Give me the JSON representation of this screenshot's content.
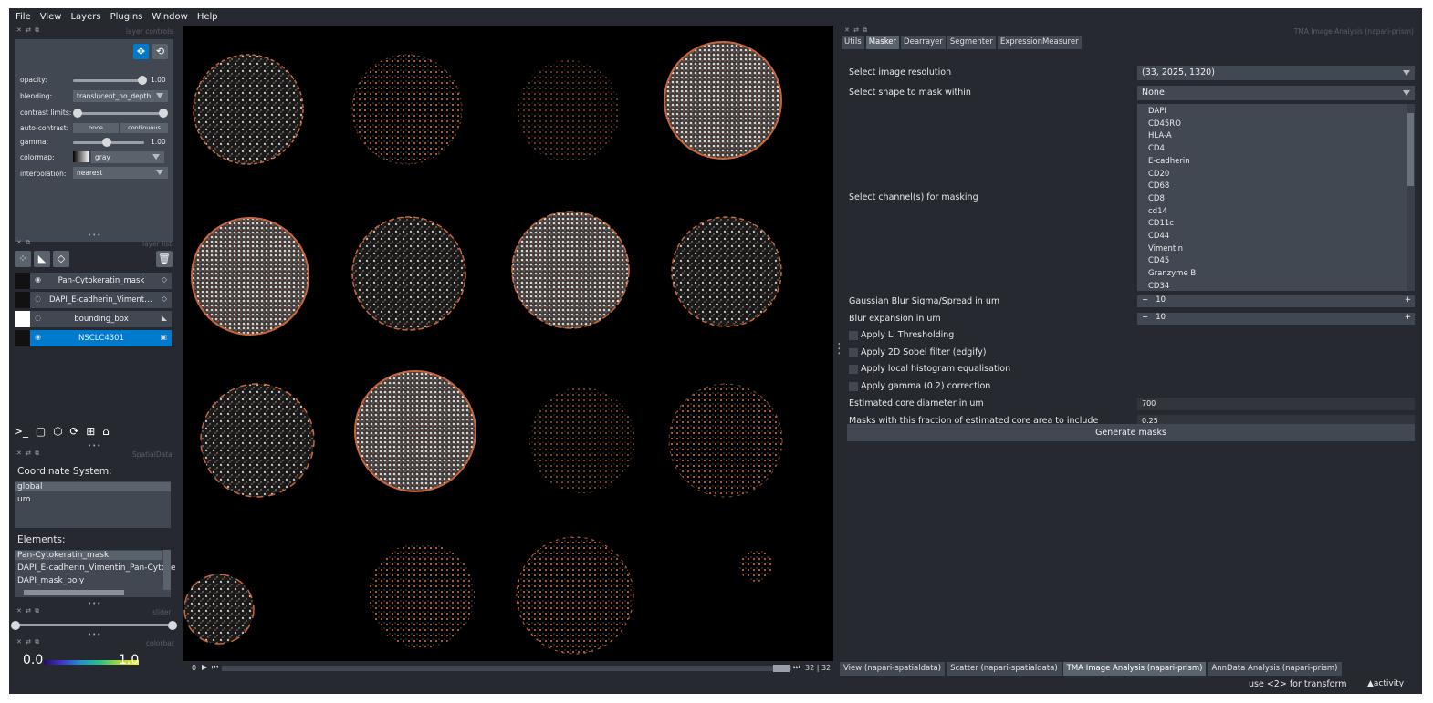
{
  "menu": [
    "File",
    "View",
    "Layers",
    "Plugins",
    "Window",
    "Help"
  ],
  "layer_controls": {
    "title": "layer controls",
    "opacity_label": "opacity:",
    "opacity_value": "1.00",
    "opacity_level": 1.0,
    "blending_label": "blending:",
    "blending_value": "translucent_no_depth",
    "contrast_label": "contrast limits:",
    "autocontrast_label": "auto-contrast:",
    "autocontrast_once": "once",
    "autocontrast_continuous": "continuous",
    "gamma_label": "gamma:",
    "gamma_value": "1.00",
    "colormap_label": "colormap:",
    "colormap_value": "gray",
    "interpolation_label": "interpolation:",
    "interpolation_value": "nearest"
  },
  "layer_list": {
    "title": "layer list",
    "layers": [
      {
        "name": "Pan-Cytokeratin_mask",
        "selected": false
      },
      {
        "name": "DAPI_E-cadherin_Vimentin...",
        "selected": false
      },
      {
        "name": "bounding_box",
        "selected": false
      },
      {
        "name": "NSCLC4301",
        "selected": true
      }
    ]
  },
  "spatialdata": {
    "title": "SpatialData",
    "coordinate_label": "Coordinate System:",
    "coordinate_systems": [
      "global",
      "um"
    ],
    "elements_label": "Elements:",
    "elements": [
      "Pan-Cytokeratin_mask",
      "DAPI_E-cadherin_Vimentin_Pan-Cytoke",
      "DAPI_mask_poly"
    ]
  },
  "slider": {
    "title": "slider"
  },
  "colorbar": {
    "title": "colorbar",
    "min": "0.0",
    "max": "1.0"
  },
  "dims": {
    "start": "0",
    "current": "32",
    "total": "32"
  },
  "right_panel": {
    "title": "TMA Image Analysis (napari-prism)",
    "tabs": [
      "Utils",
      "Masker",
      "Dearrayer",
      "Segmenter",
      "ExpressionMeasurer"
    ],
    "active_tab": "Masker",
    "resolution_label": "Select image resolution",
    "resolution_value": "(33, 2025, 1320)",
    "shape_label": "Select shape to mask within",
    "shape_value": "None",
    "channels_label": "Select channel(s) for masking",
    "channels": [
      "DAPI",
      "CD45RO",
      "HLA-A",
      "CD4",
      "E-cadherin",
      "CD20",
      "CD68",
      "CD8",
      "cd14",
      "CD11c",
      "CD44",
      "Vimentin",
      "CD45",
      "Granzyme B",
      "CD34"
    ],
    "blur_sigma_label": "Gaussian Blur Sigma/Spread in um",
    "blur_sigma_value": "10",
    "blur_exp_label": "Blur expansion in um",
    "blur_exp_value": "10",
    "checks": [
      "Apply Li Thresholding",
      "Apply 2D Sobel filter (edgify)",
      "Apply local histogram equalisation",
      "Apply gamma (0.2) correction"
    ],
    "core_diam_label": "Estimated core diameter in um",
    "core_diam_value": "700",
    "fraction_label": "Masks with this fraction of estimated core area to include",
    "fraction_value": "0.25",
    "generate_label": "Generate masks"
  },
  "bottom_tabs": [
    "View (napari-spatialdata)",
    "Scatter (napari-spatialdata)",
    "TMA Image Analysis (napari-prism)",
    "AnnData Analysis (napari-prism)"
  ],
  "active_bottom_tab": "TMA Image Analysis (napari-prism)",
  "status": {
    "hint": "use <2> for transform",
    "activity": "activity"
  }
}
